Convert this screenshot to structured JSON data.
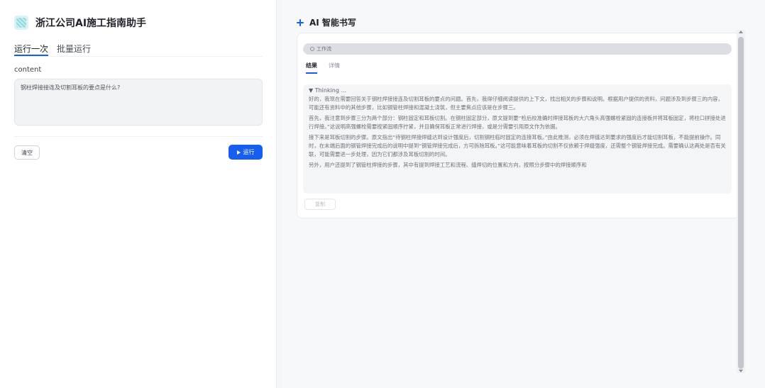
{
  "left": {
    "brand_title": "浙江公司AI施工指南助手",
    "tabs": [
      {
        "label": "运行一次",
        "active": true
      },
      {
        "label": "批量运行",
        "active": false
      }
    ],
    "field_label": "content",
    "field_value": "钢柱焊接接连及切割耳板的要点是什么?",
    "clear_label": "清空",
    "run_label": "运行"
  },
  "right": {
    "title": "AI 智能书写",
    "workflow_label": "工作流",
    "tabs": [
      {
        "label": "结果",
        "active": true
      },
      {
        "label": "详情",
        "active": false
      }
    ],
    "thinking_label": "▼ Thinking ...",
    "paragraphs": [
      "好的，我现在需要回答关于钢柱焊接接连及切割耳板的要点的问题。首先，我得仔细阅读提供的上下文，找出相关的步骤和说明。根据用户提供的资料，问题涉及到步骤三的内容，可能还有资料中的其他步骤，比如钢管柱焊接和混凝土浇筑，但主要焦点应该是在步骤三。",
      "首先，我注意到步骤三分为两个部分：钢柱固定和耳板切割。在钢柱固定部分，原文提到要“检后校准确时焊接耳板的大六角头高强螺栓紧固的连接板并将耳板固定，将柱口拼接处进行焊接。”这说明高强螺栓需要按紧固顺序拧紧，并且确保耳板正常进行焊接，或是分需要引用原文作为依据。",
      "接下来是耳板切割的步骤。原文指出“待钢柱焊接焊缝达到设计强度后，切割钢柱临时固定的连接耳板。”由此推测，必须在焊缝达到要求的强度后才能切割耳板，不能提前操作。同时，在末端后面的钢管焊接完成后的说明中提到“钢管焊接完成后，方可拆除耳板。”这可能意味着耳板的切割不仅依赖于焊缝强度，还需整个钢管焊接完成。需要确认这两处是否有关联，可能需要进一步处理，因为它们都涉及耳板切割的时间。",
      "另外，用户还提到了钢管柱焊接的步骤，其中有提到焊接工艺和流程、缝焊切的位置和方向，按照分步骤中的焊接顺序和"
    ],
    "copy_label": "复制"
  }
}
